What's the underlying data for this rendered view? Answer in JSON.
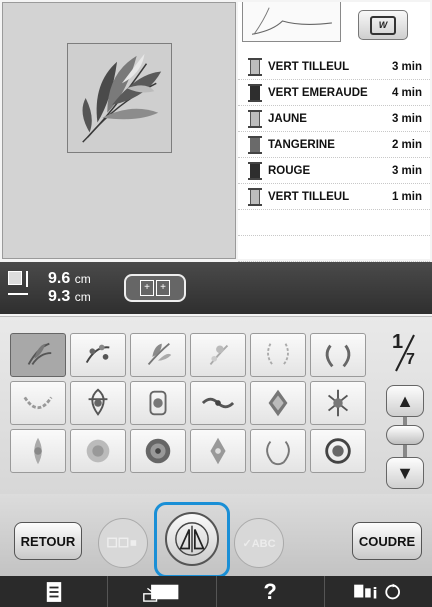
{
  "thread_colors": [
    {
      "name": "VERT TILLEUL",
      "time": "3 min",
      "swatch": "light"
    },
    {
      "name": "VERT EMERAUDE",
      "time": "4 min",
      "swatch": "dark"
    },
    {
      "name": "JAUNE",
      "time": "3 min",
      "swatch": "light"
    },
    {
      "name": "TANGERINE",
      "time": "2 min",
      "swatch": "mid"
    },
    {
      "name": "ROUGE",
      "time": "3 min",
      "swatch": "dark"
    },
    {
      "name": "VERT TILLEUL",
      "time": "1 min",
      "swatch": "light"
    }
  ],
  "size": {
    "height_value": "9.6",
    "width_value": "9.3",
    "unit": "cm"
  },
  "view_button_icon": "frame-view-icon",
  "pager": {
    "current": "1",
    "total": "7"
  },
  "buttons": {
    "back": "RETOUR",
    "sew": "COUDRE",
    "text_mode": "ABC"
  },
  "bottom_tabs": [
    "list-icon",
    "embroidery-frame-icon",
    "?",
    "settings-help-icons"
  ],
  "accent_color": "#1a8fd6"
}
